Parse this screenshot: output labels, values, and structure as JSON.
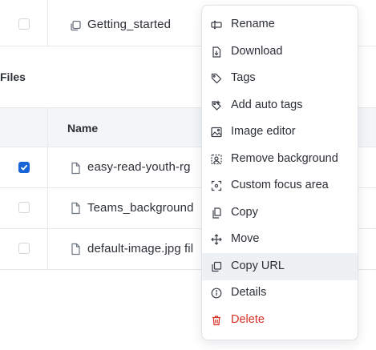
{
  "folder_row": {
    "name": "Getting_started"
  },
  "section": {
    "title": "Files"
  },
  "table": {
    "header": {
      "name_label": "Name"
    },
    "rows": [
      {
        "name": "easy-read-youth-rg",
        "checked": true
      },
      {
        "name": "Teams_background",
        "checked": false
      },
      {
        "name": "default-image.jpg fil",
        "checked": false
      }
    ]
  },
  "context_menu": {
    "items": [
      {
        "label": "Rename",
        "icon": "rename-icon"
      },
      {
        "label": "Download",
        "icon": "download-icon"
      },
      {
        "label": "Tags",
        "icon": "tag-icon"
      },
      {
        "label": "Add auto tags",
        "icon": "auto-tag-icon"
      },
      {
        "label": "Image editor",
        "icon": "image-icon"
      },
      {
        "label": "Remove background",
        "icon": "remove-background-icon"
      },
      {
        "label": "Custom focus area",
        "icon": "focus-area-icon"
      },
      {
        "label": "Copy",
        "icon": "copy-icon"
      },
      {
        "label": "Move",
        "icon": "move-icon"
      },
      {
        "label": "Copy URL",
        "icon": "copy-url-icon",
        "highlighted": true
      },
      {
        "label": "Details",
        "icon": "info-icon"
      },
      {
        "label": "Delete",
        "icon": "trash-icon",
        "danger": true
      }
    ]
  },
  "colors": {
    "accent": "#1764d6",
    "danger": "#d93025",
    "header_bg": "#f3f5f8",
    "hover_bg": "#eef1f4"
  }
}
